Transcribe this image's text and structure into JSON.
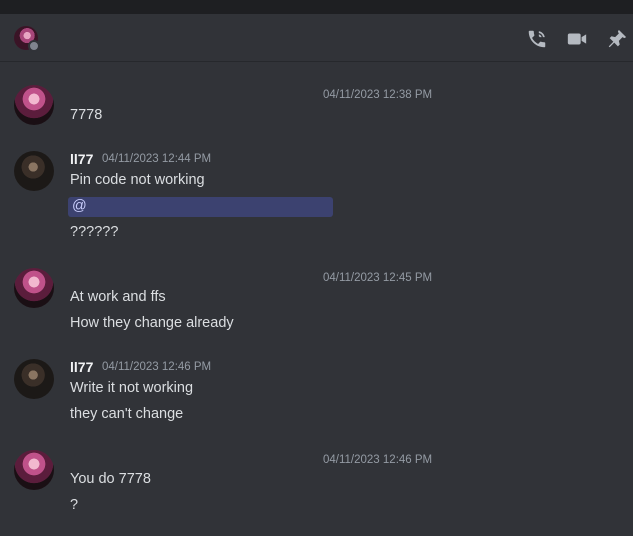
{
  "header": {
    "icons": [
      "start-voice-call-icon",
      "start-video-call-icon",
      "pinned-messages-icon"
    ],
    "status": "offline"
  },
  "messages": [
    {
      "author": "",
      "timestamp": "04/11/2023 12:38 PM",
      "lines": [
        "7778"
      ]
    },
    {
      "author": "ll77",
      "timestamp": "04/11/2023 12:44 PM",
      "lines": [
        "Pin code not working",
        "??????"
      ],
      "mention": "@"
    },
    {
      "author": "",
      "timestamp": "04/11/2023 12:45 PM",
      "lines": [
        "At work and ffs",
        "How they change already"
      ]
    },
    {
      "author": "ll77",
      "timestamp": "04/11/2023 12:46 PM",
      "lines": [
        "Write it not working",
        "they can't change"
      ]
    },
    {
      "author": "",
      "timestamp": "04/11/2023 12:46 PM",
      "lines": [
        "You do 7778",
        "?"
      ]
    }
  ],
  "colors": {
    "background": "#313338",
    "topbar": "#1e1f22",
    "mention_bg": "#3c4270",
    "mention_text": "#c9cdfb",
    "text": "#dbdee1",
    "muted": "#949ba4"
  }
}
